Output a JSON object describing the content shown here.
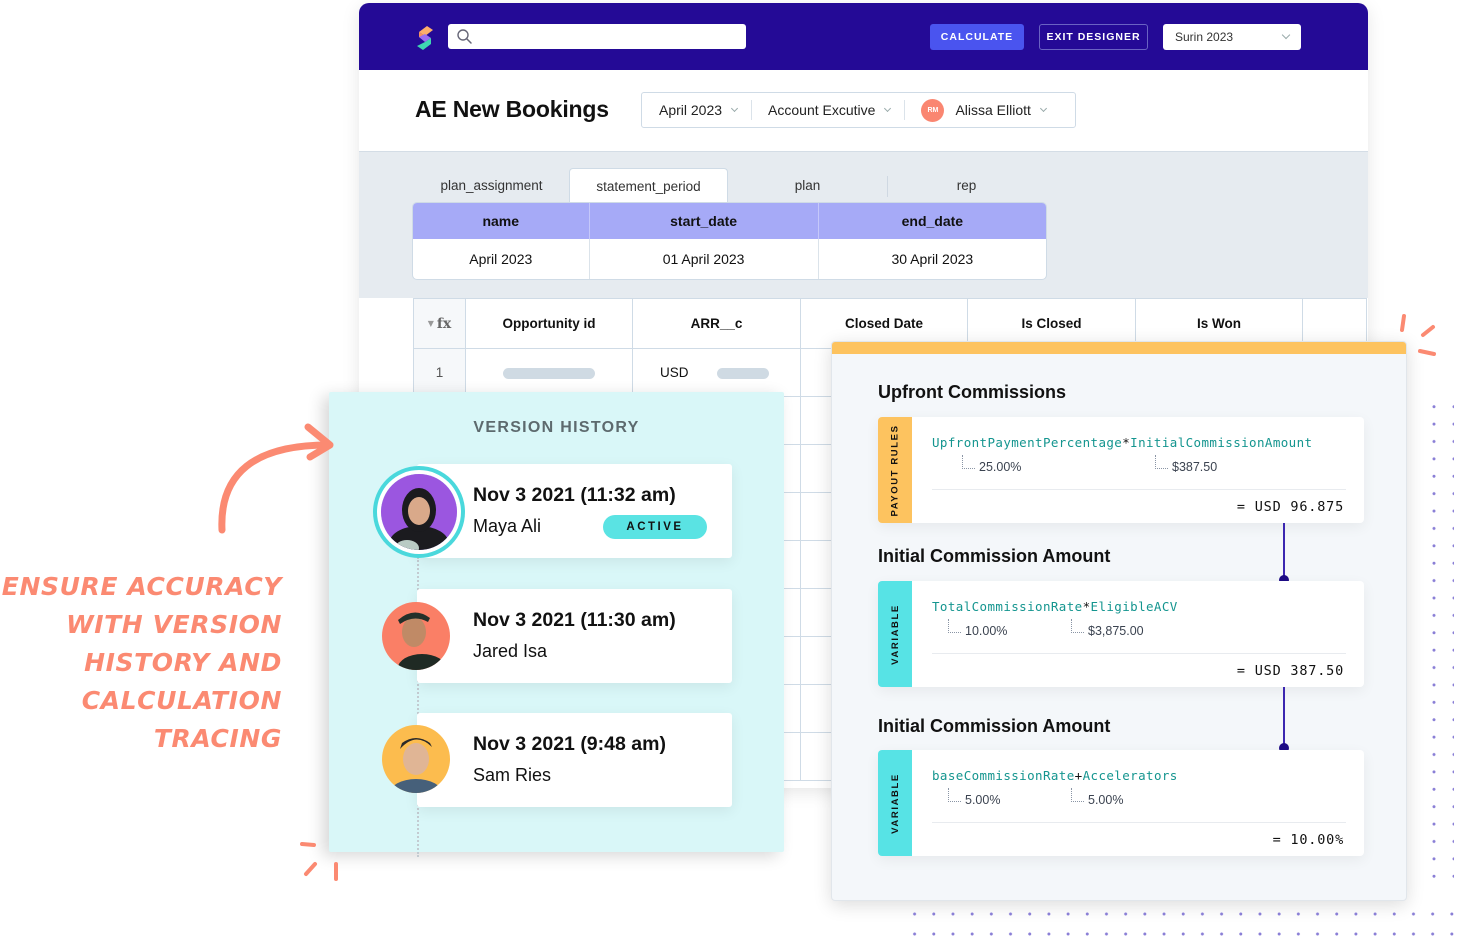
{
  "topbar": {
    "logo_icon": "spiff-logo-icon",
    "search": {
      "placeholder": "",
      "value": "",
      "icon": "search-icon"
    },
    "calculate_label": "CALCULATE",
    "exit_designer_label": "EXIT DESIGNER",
    "plan_select": {
      "value": "Surin 2023"
    }
  },
  "header": {
    "title": "AE New Bookings",
    "filters": {
      "period": "April 2023",
      "role": "Account Excutive",
      "rep": {
        "initials": "RM",
        "name": "Alissa Elliott"
      }
    }
  },
  "tabs": [
    {
      "label": "plan_assignment",
      "active": false
    },
    {
      "label": "statement_period",
      "active": true
    },
    {
      "label": "plan",
      "active": false
    },
    {
      "label": "rep",
      "active": false
    }
  ],
  "period_table": {
    "columns": [
      "name",
      "start_date",
      "end_date"
    ],
    "rows": [
      [
        "April 2023",
        "01 April 2023",
        "30 April 2023"
      ]
    ]
  },
  "data_grid": {
    "fx_label": "fx",
    "columns": [
      "Opportunity id",
      "ARR__c",
      "Closed Date",
      "Is Closed",
      "Is Won"
    ],
    "rows": [
      {
        "index": "1",
        "arr_currency": "USD"
      }
    ]
  },
  "version_history": {
    "title": "VERSION HISTORY",
    "active_label": "ACTIVE",
    "entries": [
      {
        "date": "Nov 3 2021  (11:32 am)",
        "user": "Maya Ali",
        "active": true,
        "avatar_color": "#9b56e0"
      },
      {
        "date": "Nov 3 2021  (11:30 am)",
        "user": "Jared Isa",
        "active": false,
        "avatar_color": "#fa7f66"
      },
      {
        "date": "Nov 3 2021  (9:48 am)",
        "user": "Sam Ries",
        "active": false,
        "avatar_color": "#fcbc4e"
      }
    ]
  },
  "trace": {
    "sections": [
      {
        "title": "Upfront Commissions",
        "tag": "PAYOUT RULES",
        "tag_color": "#fdc35f",
        "left_operand": "UpfrontPaymentPercentage",
        "operator": "*",
        "right_operand": "InitialCommissionAmount",
        "left_value": "25.00%",
        "right_value": "$387.50",
        "result": "= USD 96.875"
      },
      {
        "title": "Initial Commission Amount",
        "tag": "VARIABLE",
        "tag_color": "#57e3e5",
        "left_operand": "TotalCommissionRate",
        "operator": "*",
        "right_operand": "EligibleACV",
        "left_value": "10.00%",
        "right_value": "$3,875.00",
        "result": "= USD 387.50"
      },
      {
        "title": "Initial Commission Amount",
        "tag": "VARIABLE",
        "tag_color": "#57e3e5",
        "left_operand": "baseCommissionRate",
        "operator": "+",
        "right_operand": "Accelerators",
        "left_value": "5.00%",
        "right_value": "5.00%",
        "result": "= 10.00%"
      }
    ]
  },
  "tagline": {
    "lines": [
      "Ensure accuracy",
      "with version",
      "history and",
      "calculation",
      "tracing"
    ]
  },
  "colors": {
    "brand_navy": "#240a96",
    "accent_blue": "#4a54ef",
    "header_purple": "#a6aaf7",
    "accent_coral": "#fb8a72",
    "accent_yellow": "#fdc35f",
    "accent_cyan": "#57e3e5",
    "formula_teal": "#14958f"
  }
}
